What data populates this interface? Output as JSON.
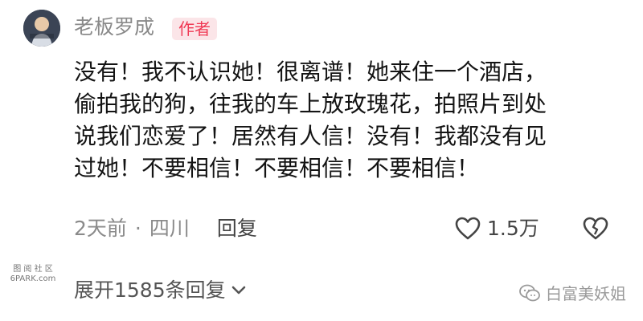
{
  "author": {
    "name": "老板罗成",
    "badge": "作者"
  },
  "comment": {
    "lines": [
      "没有！我不认识她！很离谱！她来住一个酒店，",
      "偷拍我的狗，往我的车上放玫瑰花，拍照片到处",
      "说我们恋爱了！居然有人信！没有！我都没有见",
      "过她！不要相信！不要相信！不要相信！"
    ]
  },
  "meta": {
    "time": "2天前",
    "separator": "·",
    "location": "四川",
    "reply_label": "回复"
  },
  "actions": {
    "like_count": "1.5万",
    "like_icon": "heart-outline-icon",
    "dislike_icon": "broken-heart-icon"
  },
  "watermarks": {
    "side_top": "图 阅 社 区",
    "side_bottom": "6PARK.com",
    "wechat_account": "白富美妖姐"
  },
  "replies": {
    "expand_label": "展开1585条回复"
  },
  "colors": {
    "badge_bg": "#fbe5e8",
    "badge_text": "#f03a55",
    "meta_text": "#8a8a8a",
    "body_text": "#141414"
  }
}
